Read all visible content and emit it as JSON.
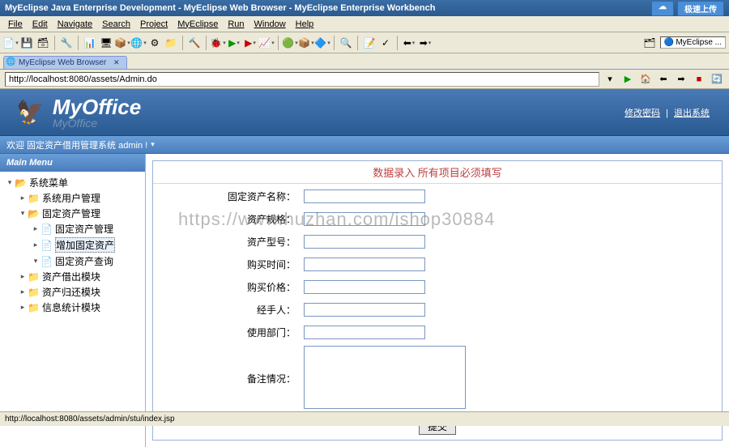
{
  "titlebar": {
    "text": "MyEclipse Java Enterprise Development - MyEclipse Web Browser - MyEclipse Enterprise Workbench",
    "upload_btn": "极速上传"
  },
  "menubar": [
    "File",
    "Edit",
    "Navigate",
    "Search",
    "Project",
    "MyEclipse",
    "Run",
    "Window",
    "Help"
  ],
  "quick_access": "MyEclipse ...",
  "tab": {
    "label": "MyEclipse Web Browser",
    "close": "✕"
  },
  "address": "http://localhost:8080/assets/Admin.do",
  "app": {
    "logo": "MyOffice",
    "logo_shadow": "MyOffice",
    "link_pwd": "修改密码",
    "link_exit": "退出系统"
  },
  "welcome": "欢迎 固定资产借用管理系统 admin !",
  "sidebar": {
    "title": "Main Menu",
    "root": "系统菜单",
    "items": [
      {
        "label": "系统用户管理",
        "leaf": true
      },
      {
        "label": "固定资产管理",
        "leaf": false,
        "expanded": true,
        "children": [
          {
            "label": "固定资产管理"
          },
          {
            "label": "增加固定资产",
            "selected": true
          },
          {
            "label": "固定资产查询"
          }
        ]
      },
      {
        "label": "资产借出模块",
        "leaf": true
      },
      {
        "label": "资产归还模块",
        "leaf": true
      },
      {
        "label": "信息统计模块",
        "leaf": true
      }
    ]
  },
  "form": {
    "title": "数据录入 所有项目必须填写",
    "fields": [
      "固定资产名称：",
      "资产规格：",
      "资产型号：",
      "购买时间：",
      "购买价格：",
      "经手人：",
      "使用部门："
    ],
    "remark_label": "备注情况：",
    "submit": "提交"
  },
  "statusbar": "http://localhost:8080/assets/admin/stu/index.jsp",
  "watermark": "https://www.huzhan.com/ishop30884"
}
